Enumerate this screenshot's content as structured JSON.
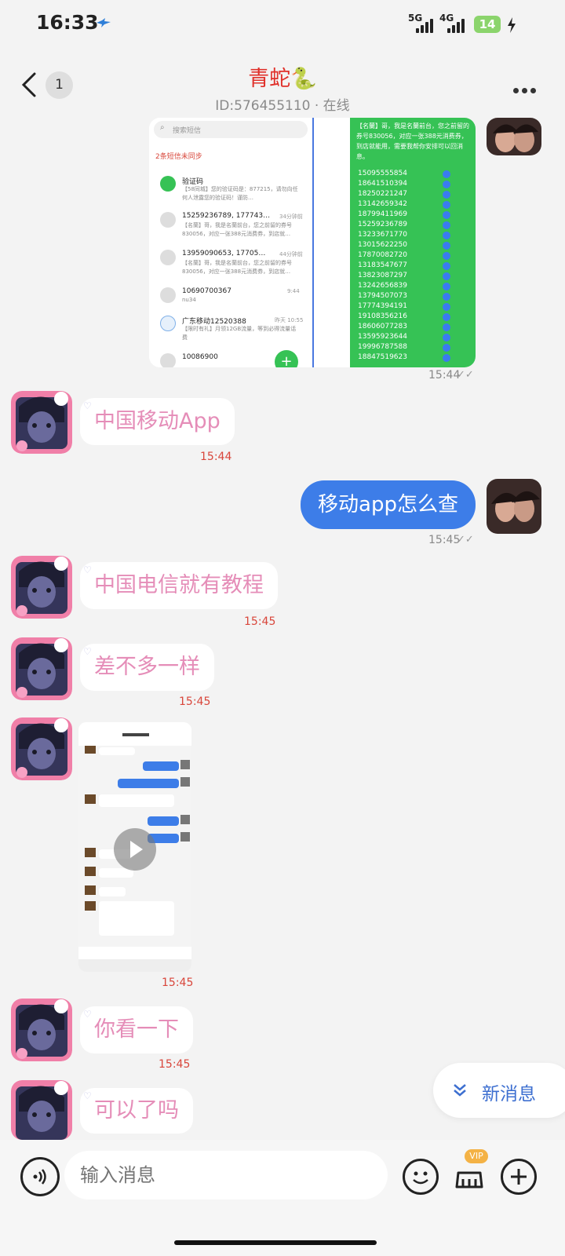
{
  "status_bar": {
    "time": "16:33",
    "network_1": "5G",
    "network_2": "4G",
    "battery": "14"
  },
  "header": {
    "unread_count": "1",
    "contact_name": "青蛇🐍",
    "contact_sub": "ID:576455110 · 在线"
  },
  "sms_screenshot": {
    "search_placeholder": "搜索短信",
    "sync_notice": "2条短信未同步",
    "items": [
      {
        "title": "验证码",
        "preview": "【58同城】您的验证码是：877215，请勿向任何人泄露您的验证码！谨防…"
      },
      {
        "title": "15259236789, 177743…",
        "time": "34分钟前",
        "preview": "【名蘭】哥，我是名蘭前台，您之前留的券号830056，对应一张388元消费券，到店就…"
      },
      {
        "title": "13959090653, 17705…",
        "time": "44分钟前",
        "preview": "【名蘭】哥，我是名蘭前台，您之前留的券号830056，对应一张388元消费券，到店就…"
      },
      {
        "title": "10690700367",
        "time": "9:44",
        "preview": "nu34"
      },
      {
        "title": "广东移动12520388",
        "time": "昨天 10:55",
        "preview": "【限时有礼】月领12GB流量，等到必得流量话费"
      },
      {
        "title": "10086900",
        "time": "",
        "preview": ""
      }
    ],
    "green_message": "【名蘭】哥，我是名蘭前台，您之前留的券号830056，对应一张388元消费券，到店就能用，需要我帮你安排可以回消息。",
    "numbers": [
      "15095555854",
      "18641510394",
      "18250221247",
      "13142659342",
      "18799411969",
      "15259236789",
      "13233671770",
      "13015622250",
      "17870082720",
      "13183547677",
      "13823087297",
      "13242656839",
      "13794507073",
      "17774394191",
      "19108356216",
      "18606077283",
      "13595923644",
      "19996787588",
      "18847519623"
    ]
  },
  "messages": [
    {
      "side": "right",
      "type": "image",
      "time": "15:44"
    },
    {
      "side": "left",
      "text": "中国移动App",
      "time": "15:44"
    },
    {
      "side": "right",
      "text": "移动app怎么查",
      "time": "15:45"
    },
    {
      "side": "left",
      "text": "中国电信就有教程",
      "time": "15:45"
    },
    {
      "side": "left",
      "text": "差不多一样",
      "time": "15:45"
    },
    {
      "side": "left",
      "type": "video",
      "time": "15:45"
    },
    {
      "side": "left",
      "text": "你看一下",
      "time": "15:45"
    },
    {
      "side": "left",
      "text": "可以了吗",
      "time": ""
    }
  ],
  "new_message_label": "新消息",
  "input": {
    "placeholder": "输入消息"
  },
  "vip_label": "VIP",
  "colors": {
    "accent": "#3d7de8",
    "name_red": "#e0302a",
    "bubble_pink_text": "#e58db8",
    "time_red": "#d9463b"
  }
}
